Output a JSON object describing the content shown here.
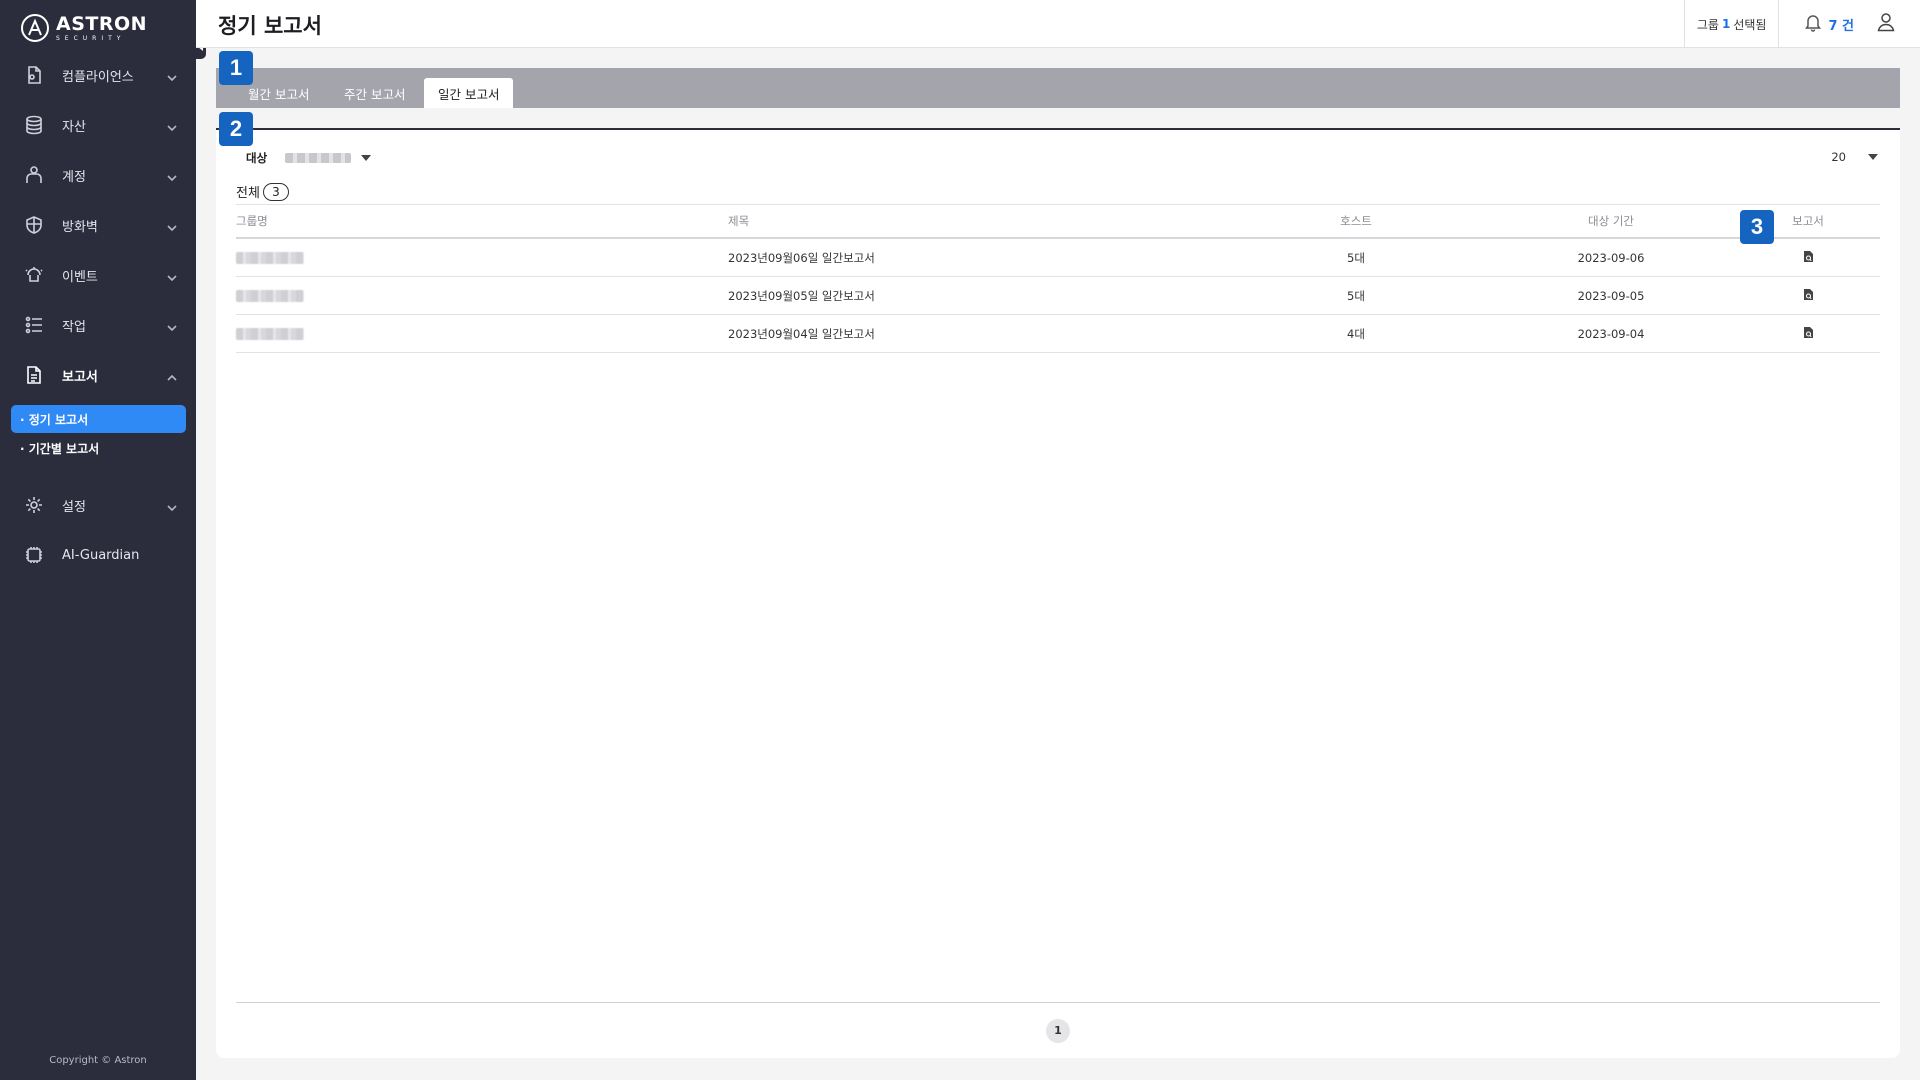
{
  "brand": {
    "name": "ASTRON",
    "sub": "SECURITY"
  },
  "sidebar": {
    "items": [
      {
        "label": "컴플라이언스",
        "icon": "compliance-icon"
      },
      {
        "label": "자산",
        "icon": "database-icon"
      },
      {
        "label": "계정",
        "icon": "account-icon"
      },
      {
        "label": "방화벽",
        "icon": "shield-icon"
      },
      {
        "label": "이벤트",
        "icon": "event-icon"
      },
      {
        "label": "작업",
        "icon": "task-list-icon"
      },
      {
        "label": "보고서",
        "icon": "document-icon"
      },
      {
        "label": "설정",
        "icon": "gear-icon"
      },
      {
        "label": "AI-Guardian",
        "icon": "ai-chip-icon"
      }
    ],
    "report_submenu": [
      {
        "label": "· 정기 보고서",
        "selected": true
      },
      {
        "label": "· 기간별 보고서",
        "selected": false
      }
    ],
    "copyright": "Copyright © Astron"
  },
  "header": {
    "title": "정기 보고서",
    "group_prefix": "그룹",
    "group_count": "1",
    "group_suffix": "선택됨",
    "notification_count": "7 건"
  },
  "tabs": [
    {
      "label": "월간 보고서",
      "active": false
    },
    {
      "label": "주간 보고서",
      "active": false
    },
    {
      "label": "일간 보고서",
      "active": true
    }
  ],
  "filter": {
    "label": "대상",
    "page_size": "20"
  },
  "total": {
    "label": "전체",
    "count": "3"
  },
  "table": {
    "columns": [
      "그룹명",
      "제목",
      "호스트",
      "대상 기간",
      "보고서"
    ],
    "rows": [
      {
        "title": "2023년09월06일 일간보고서",
        "hosts": "5대",
        "period": "2023-09-06"
      },
      {
        "title": "2023년09월05일 일간보고서",
        "hosts": "5대",
        "period": "2023-09-05"
      },
      {
        "title": "2023년09월04일 일간보고서",
        "hosts": "4대",
        "period": "2023-09-04"
      }
    ]
  },
  "pagination": {
    "current": "1"
  },
  "badges": [
    "1",
    "2",
    "3"
  ],
  "colors": {
    "sidebar_bg": "#2b2d3c",
    "accent": "#2f8af5",
    "badge": "#1565c0",
    "tabbar_bg": "#a4a5ac"
  }
}
